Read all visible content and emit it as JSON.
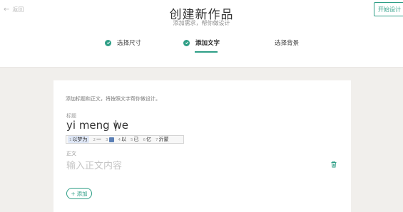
{
  "header": {
    "back_label": "返回",
    "title": "创建新作品",
    "subtitle": "添加需求，帮你做设计",
    "start_button": "开始设计"
  },
  "steps": [
    {
      "label": "选择尺寸",
      "done": true
    },
    {
      "label": "添加文字",
      "done": true,
      "active": true
    },
    {
      "label": "选择背景",
      "done": false
    }
  ],
  "form": {
    "hint": "添加标题和正文，将按照文字帮你做设计。",
    "title_label": "标题",
    "title_value": "yi meng we",
    "body_label": "正文",
    "body_placeholder": "输入正文内容",
    "add_button": "添加"
  },
  "ime": {
    "candidates": [
      {
        "num": "1",
        "text": "以梦为",
        "selected": true
      },
      {
        "num": "2",
        "text": "一"
      },
      {
        "num": "3",
        "text": "",
        "emoji": true
      },
      {
        "num": "4",
        "text": "以"
      },
      {
        "num": "5",
        "text": "已"
      },
      {
        "num": "6",
        "text": "亿"
      },
      {
        "num": "7",
        "text": "沂蒙"
      }
    ]
  },
  "colors": {
    "accent": "#2e9e86",
    "background": "#f1efec"
  }
}
